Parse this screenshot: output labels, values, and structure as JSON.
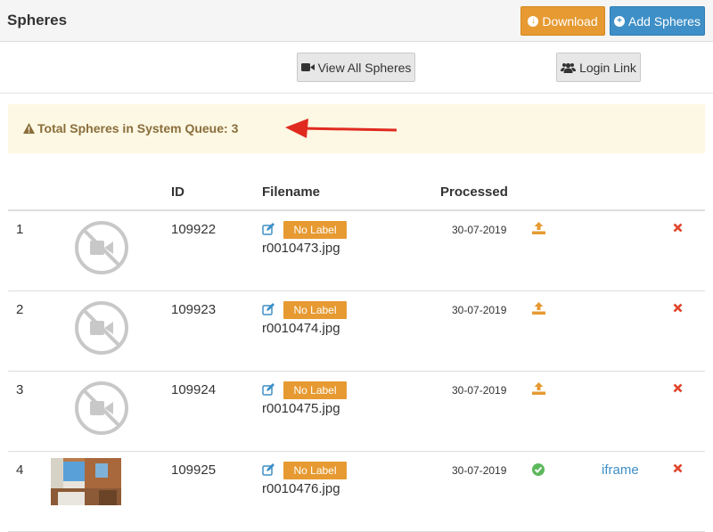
{
  "header": {
    "title": "Spheres",
    "download_label": "Download",
    "add_label": "Add Spheres"
  },
  "toolbar": {
    "view_all_label": "View All Spheres",
    "login_link_label": "Login Link"
  },
  "alert": {
    "text": "Total Spheres in System Queue: 3"
  },
  "table": {
    "headers": {
      "id": "ID",
      "filename": "Filename",
      "processed": "Processed"
    },
    "rows": [
      {
        "num": "1",
        "id": "109922",
        "label": "No Label",
        "filename": "r0010473.jpg",
        "processed": "30-07-2019",
        "status_icon": "upload-icon",
        "iframe": "",
        "thumb": "no-video-icon"
      },
      {
        "num": "2",
        "id": "109923",
        "label": "No Label",
        "filename": "r0010474.jpg",
        "processed": "30-07-2019",
        "status_icon": "upload-icon",
        "iframe": "",
        "thumb": "no-video-icon"
      },
      {
        "num": "3",
        "id": "109924",
        "label": "No Label",
        "filename": "r0010475.jpg",
        "processed": "30-07-2019",
        "status_icon": "upload-icon",
        "iframe": "",
        "thumb": "no-video-icon"
      },
      {
        "num": "4",
        "id": "109925",
        "label": "No Label",
        "filename": "r0010476.jpg",
        "processed": "30-07-2019",
        "status_icon": "check-circle-icon",
        "iframe": "iframe",
        "thumb": "photo-thumbnail"
      }
    ]
  },
  "colors": {
    "orange": "#e69a31",
    "blue": "#3e8fc7",
    "alert_bg": "#fcf8e3",
    "alert_text": "#8a6d3b",
    "danger": "#e0442a",
    "success": "#5cb85c"
  }
}
